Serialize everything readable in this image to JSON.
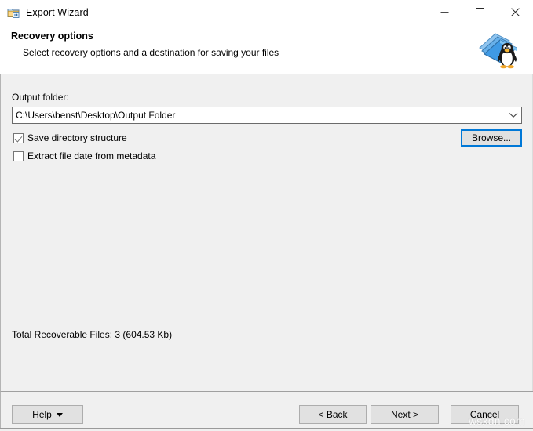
{
  "window": {
    "title": "Export Wizard",
    "title_icon": "export-folder-icon",
    "minimize_glyph": "—",
    "maximize_glyph": "□",
    "close_glyph": "✕"
  },
  "header": {
    "title": "Recovery options",
    "subtitle": "Select recovery options and a destination for saving your files",
    "icon": "linux-penguin-book-icon"
  },
  "main": {
    "output_folder_label": "Output folder:",
    "output_folder_value": "C:\\Users\\benst\\Desktop\\Output Folder",
    "dropdown_arrow": "chevron-down-icon",
    "browse_label": "Browse...",
    "checkboxes": [
      {
        "label": "Save directory structure",
        "checked": true
      },
      {
        "label": "Extract file date from metadata",
        "checked": false
      }
    ],
    "total_files": "Total Recoverable Files: 3 (604.53 Kb)"
  },
  "footer": {
    "help_label": "Help",
    "back_label": "< Back",
    "next_label": "Next >",
    "cancel_label": "Cancel"
  },
  "watermark": {
    "text": "wsxdn.com"
  },
  "background": {
    "cutoff_text": ""
  },
  "colors": {
    "accent": "#0078d7",
    "content_bg": "#f0f0f0",
    "button_bg": "#e1e1e1",
    "border": "#adadad",
    "field_border": "#6b6b6b"
  }
}
